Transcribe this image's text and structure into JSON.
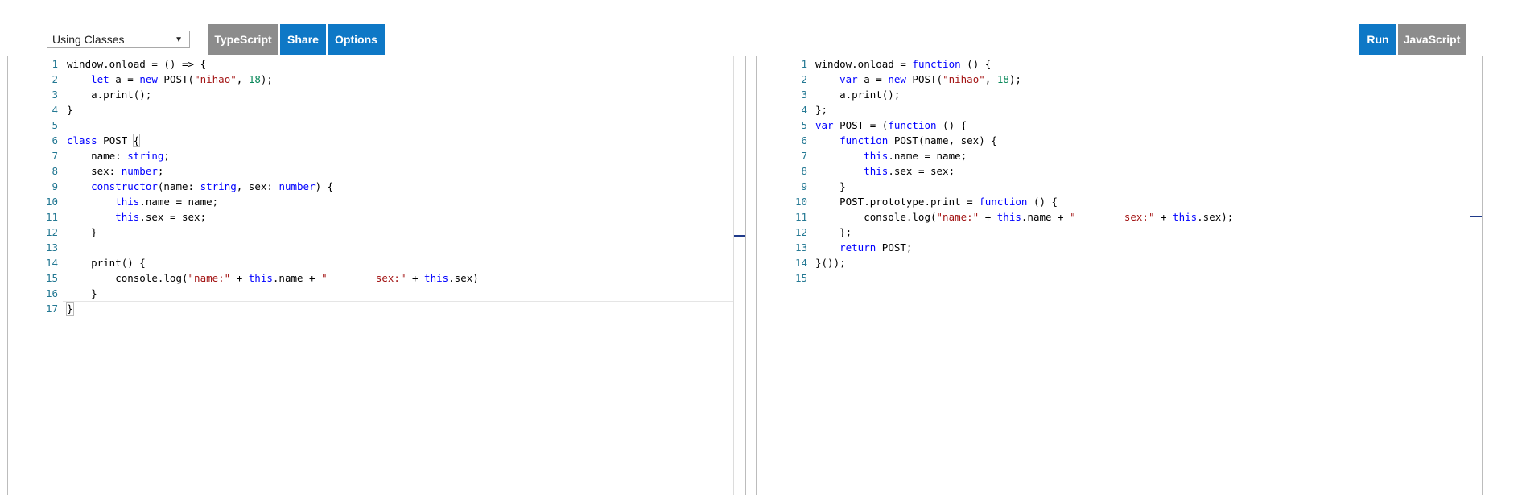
{
  "toolbar": {
    "example_select": "Using Classes",
    "typescript_label": "TypeScript",
    "share_label": "Share",
    "options_label": "Options",
    "run_label": "Run",
    "javascript_label": "JavaScript"
  },
  "left_editor": {
    "line_numbers": [
      "1",
      "2",
      "3",
      "4",
      "5",
      "6",
      "7",
      "8",
      "9",
      "10",
      "11",
      "12",
      "13",
      "14",
      "15",
      "16",
      "17"
    ],
    "lines": [
      "window.onload = () => {",
      "    let a = new POST(\"nihao\", 18);",
      "    a.print();",
      "}",
      "",
      "class POST {",
      "    name: string;",
      "    sex: number;",
      "    constructor(name: string, sex: number) {",
      "        this.name = name;",
      "        this.sex = sex;",
      "    }",
      "",
      "    print() {",
      "        console.log(\"name:\" + this.name + \"        sex:\" + this.sex)",
      "    }",
      "}"
    ]
  },
  "right_editor": {
    "line_numbers": [
      "1",
      "2",
      "3",
      "4",
      "5",
      "6",
      "7",
      "8",
      "9",
      "10",
      "11",
      "12",
      "13",
      "14",
      "15"
    ],
    "lines": [
      "window.onload = function () {",
      "    var a = new POST(\"nihao\", 18);",
      "    a.print();",
      "};",
      "var POST = (function () {",
      "    function POST(name, sex) {",
      "        this.name = name;",
      "        this.sex = sex;",
      "    }",
      "    POST.prototype.print = function () {",
      "        console.log(\"name:\" + this.name + \"        sex:\" + this.sex);",
      "    };",
      "    return POST;",
      "}());",
      ""
    ]
  }
}
